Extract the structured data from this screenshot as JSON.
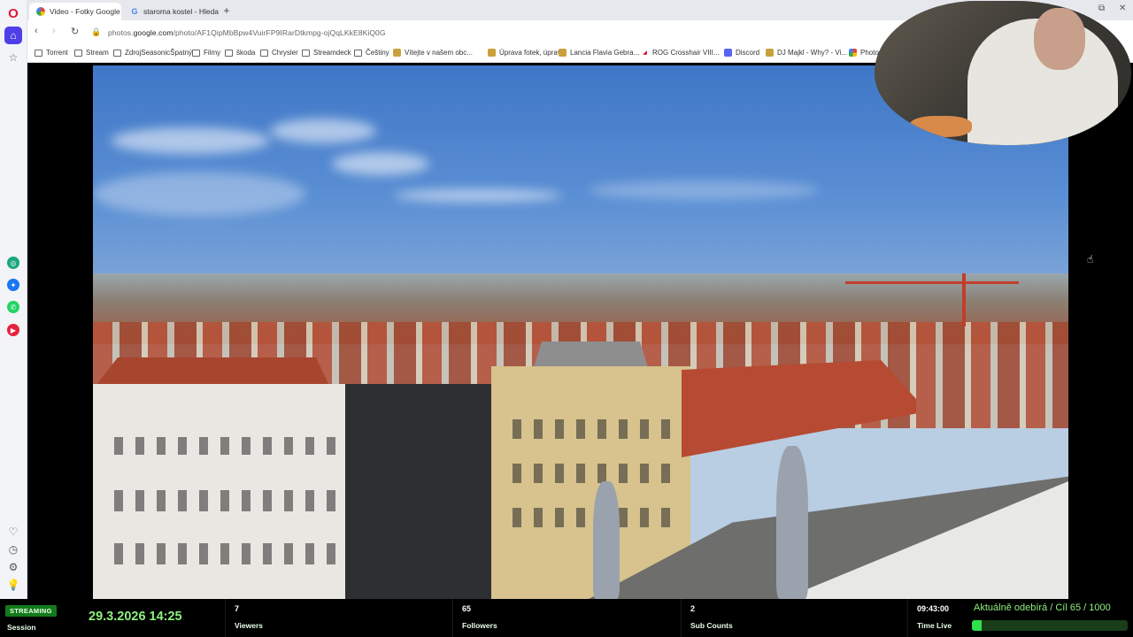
{
  "browser": {
    "tabs": [
      {
        "title": "Video - Fotky Google",
        "icon": "google-photos-icon",
        "active": true
      },
      {
        "title": "staroma kostel - Hledat G",
        "icon": "google-icon",
        "active": false
      }
    ],
    "url": {
      "prefix": "photos.",
      "domain": "google.com",
      "path": "/photo/AF1QipMbBpw4VuirFP9IRarDtkmpg-ojQqLKkE8KiQ0G"
    },
    "bookmarks": [
      {
        "label": "Torrent",
        "icon": "folder-icon"
      },
      {
        "label": "Stream",
        "icon": "folder-icon"
      },
      {
        "label": "ZdrojSeasonicŠpatný",
        "icon": "folder-icon"
      },
      {
        "label": "Filmy",
        "icon": "folder-icon"
      },
      {
        "label": "škoda",
        "icon": "folder-icon"
      },
      {
        "label": "Chrysler",
        "icon": "folder-icon"
      },
      {
        "label": "Streamdeck",
        "icon": "folder-icon"
      },
      {
        "label": "Češtiny",
        "icon": "folder-icon"
      },
      {
        "label": "Vítejte v našem obc...",
        "icon": "site-icon"
      },
      {
        "label": "Úprava fotek, úprav...",
        "icon": "site-icon"
      },
      {
        "label": "Lancia Flavia Gebra...",
        "icon": "site-icon"
      },
      {
        "label": "ROG Crosshair VIII...",
        "icon": "rog-icon"
      },
      {
        "label": "Discord",
        "icon": "discord-icon"
      },
      {
        "label": "DJ Majkl - Why? - Vi...",
        "icon": "site-icon"
      },
      {
        "label": "Photo",
        "icon": "photos-icon"
      }
    ]
  },
  "stream": {
    "badge": "STREAMING",
    "session_label": "Session",
    "date": "29.3.2026 14:25",
    "viewers": {
      "value": "7",
      "label": "Viewers"
    },
    "followers": {
      "value": "65",
      "label": "Followers"
    },
    "subs": {
      "value": "2",
      "label": "Sub Counts"
    },
    "time_live": {
      "value": "09:43:00",
      "label": "Time Live"
    },
    "goal_text": "Aktuálně odebírá / Cíl  65 / 1000",
    "goal_current": 65,
    "goal_target": 1000
  },
  "colors": {
    "accent_green": "#2fe04a",
    "label_green": "#8ff07f",
    "opera_red": "#e0152f",
    "opera_home": "#4f3fe8"
  }
}
